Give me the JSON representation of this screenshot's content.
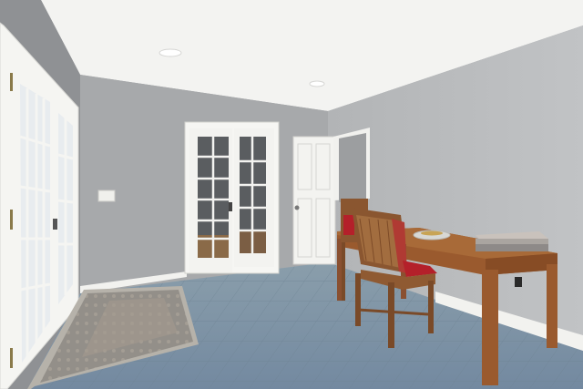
{
  "scene": {
    "kind": "photograph",
    "subject": "interior room",
    "colors": {
      "ceiling": "#f4f4f2",
      "wall_back": "#a9abad",
      "wall_right": "#b7b9bb",
      "wall_left": "#8f9194",
      "floor_tile": "#7f93a2",
      "trim": "#f2f2ef",
      "desk_wood": "#9a5a2e",
      "chair_wood": "#8a5630",
      "cushion_red": "#b4202a",
      "rug": "#8f8c86"
    }
  }
}
